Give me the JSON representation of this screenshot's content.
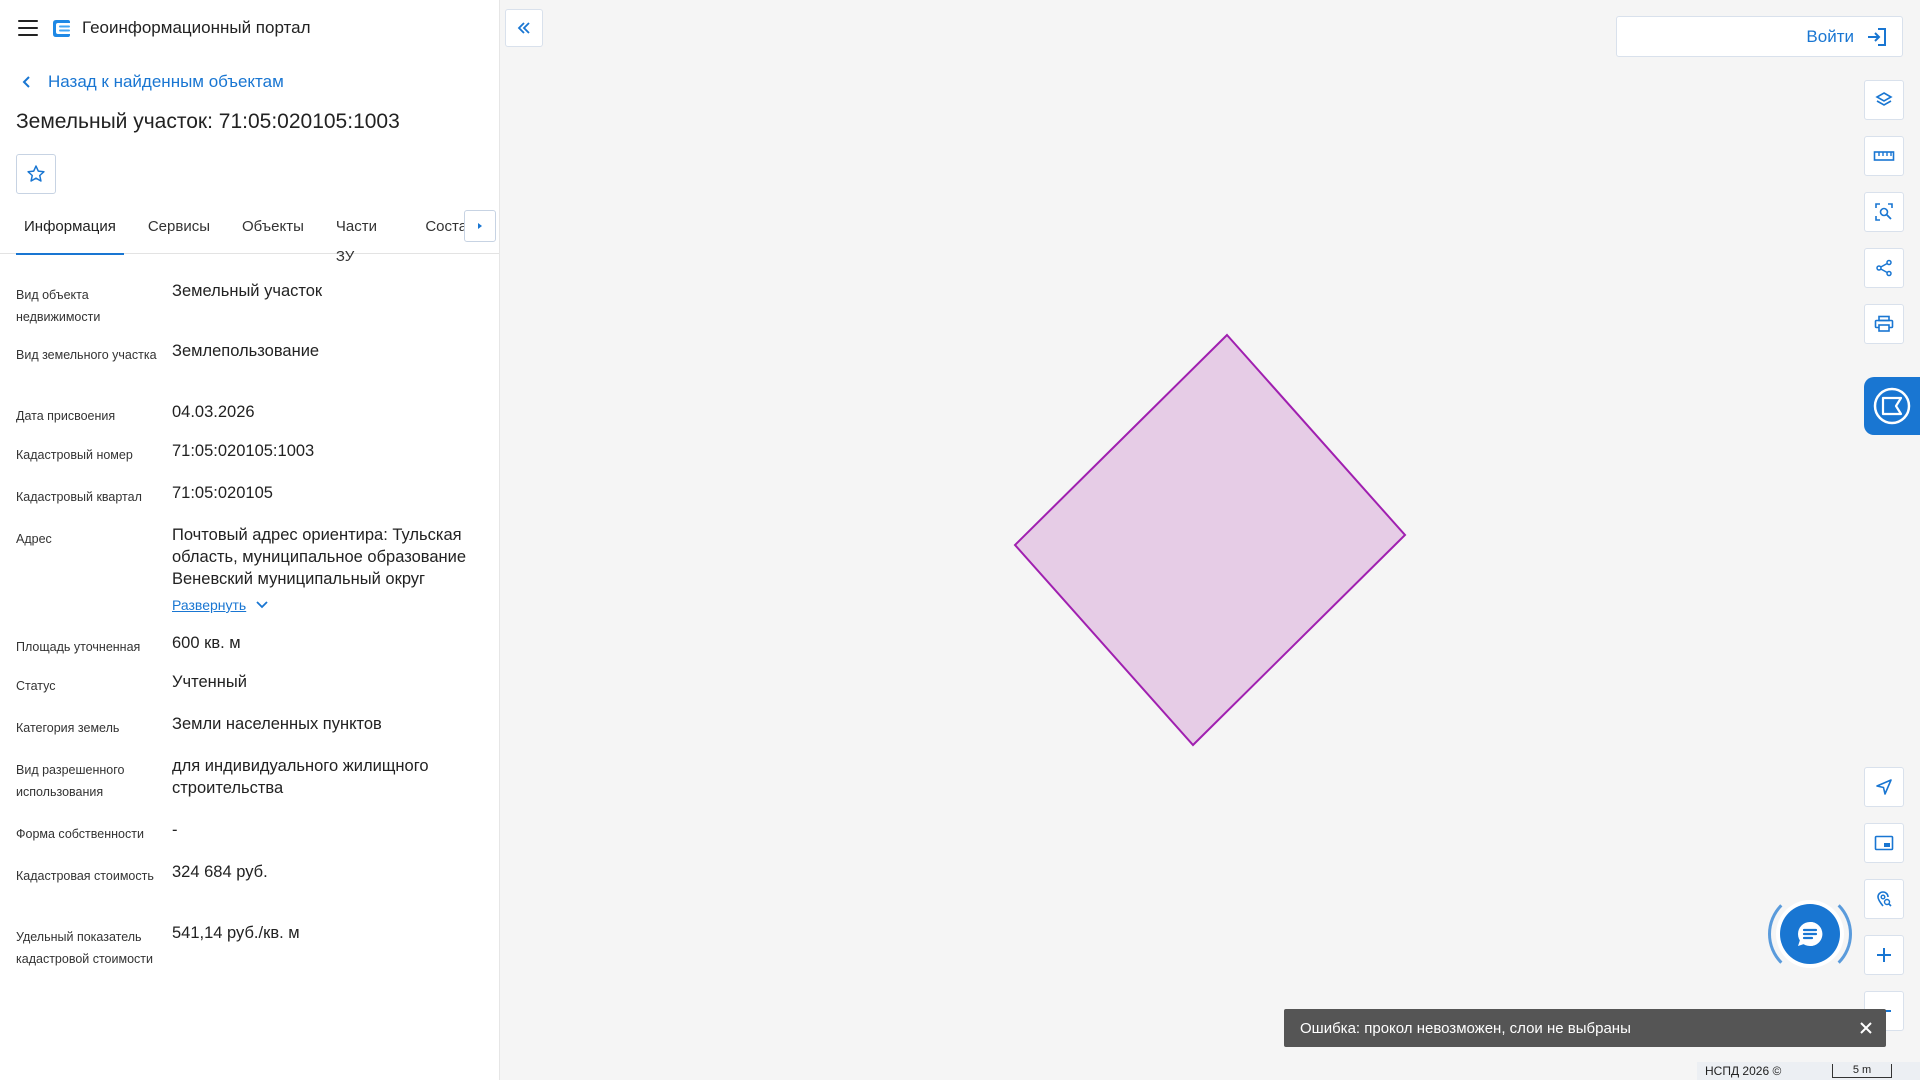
{
  "header": {
    "menu_icon": "hamburger-icon",
    "logo_icon": "portal-logo-icon",
    "app_title": "Геоинформационный портал"
  },
  "nav": {
    "back_label": "Назад к найденным объектам"
  },
  "object": {
    "title": "Земельный участок: 71:05:020105:1003"
  },
  "tabs": [
    {
      "label": "Информация",
      "active": true
    },
    {
      "label": "Сервисы"
    },
    {
      "label": "Объекты"
    },
    {
      "label": "Части ЗУ"
    },
    {
      "label": "Состав"
    }
  ],
  "properties": [
    {
      "label": "Вид объекта недвижимости",
      "value": "Земельный участок"
    },
    {
      "label": "Вид земельного участка",
      "value": "Землепользование"
    },
    {
      "label": "Дата присвоения",
      "value": "04.03.2026"
    },
    {
      "label": "Кадастровый номер",
      "value": "71:05:020105:1003"
    },
    {
      "label": "Кадастровый квартал",
      "value": "71:05:020105"
    },
    {
      "label": "Адрес",
      "value": "Почтовый адрес ориентира: Тульская область, муниципальное образование Веневский муниципальный округ",
      "expand_label": "Развернуть"
    },
    {
      "label": "Площадь уточненная",
      "value": "600 кв. м"
    },
    {
      "label": "Статус",
      "value": "Учтенный"
    },
    {
      "label": "Категория земель",
      "value": "Земли населенных пунктов"
    },
    {
      "label": "Вид разрешенного использования",
      "value": "для индивидуального жилищного строительства"
    },
    {
      "label": "Форма собственности",
      "value": "-"
    },
    {
      "label": "Кадастровая стоимость",
      "value": "324 684 руб."
    },
    {
      "label": "Удельный показатель кадастровой стоимости",
      "value": "541,14 руб./кв. м"
    }
  ],
  "map": {
    "login_label": "Войти",
    "tools_top": [
      "layers-icon",
      "ruler-icon",
      "area-search-icon",
      "share-icon",
      "print-icon"
    ],
    "tools_bottom": [
      "locate-icon",
      "minimap-icon",
      "point-info-icon",
      "zoom-in-icon",
      "zoom-out-icon"
    ],
    "parcel_fill": "#e6cce6",
    "parcel_stroke": "#a020b0",
    "toast_text": "Ошибка: прокол невозможен, слои не выбраны",
    "attribution": "НСПД 2026 ©",
    "scale_label": "5 m"
  },
  "colors": {
    "accent": "#1976d2"
  }
}
